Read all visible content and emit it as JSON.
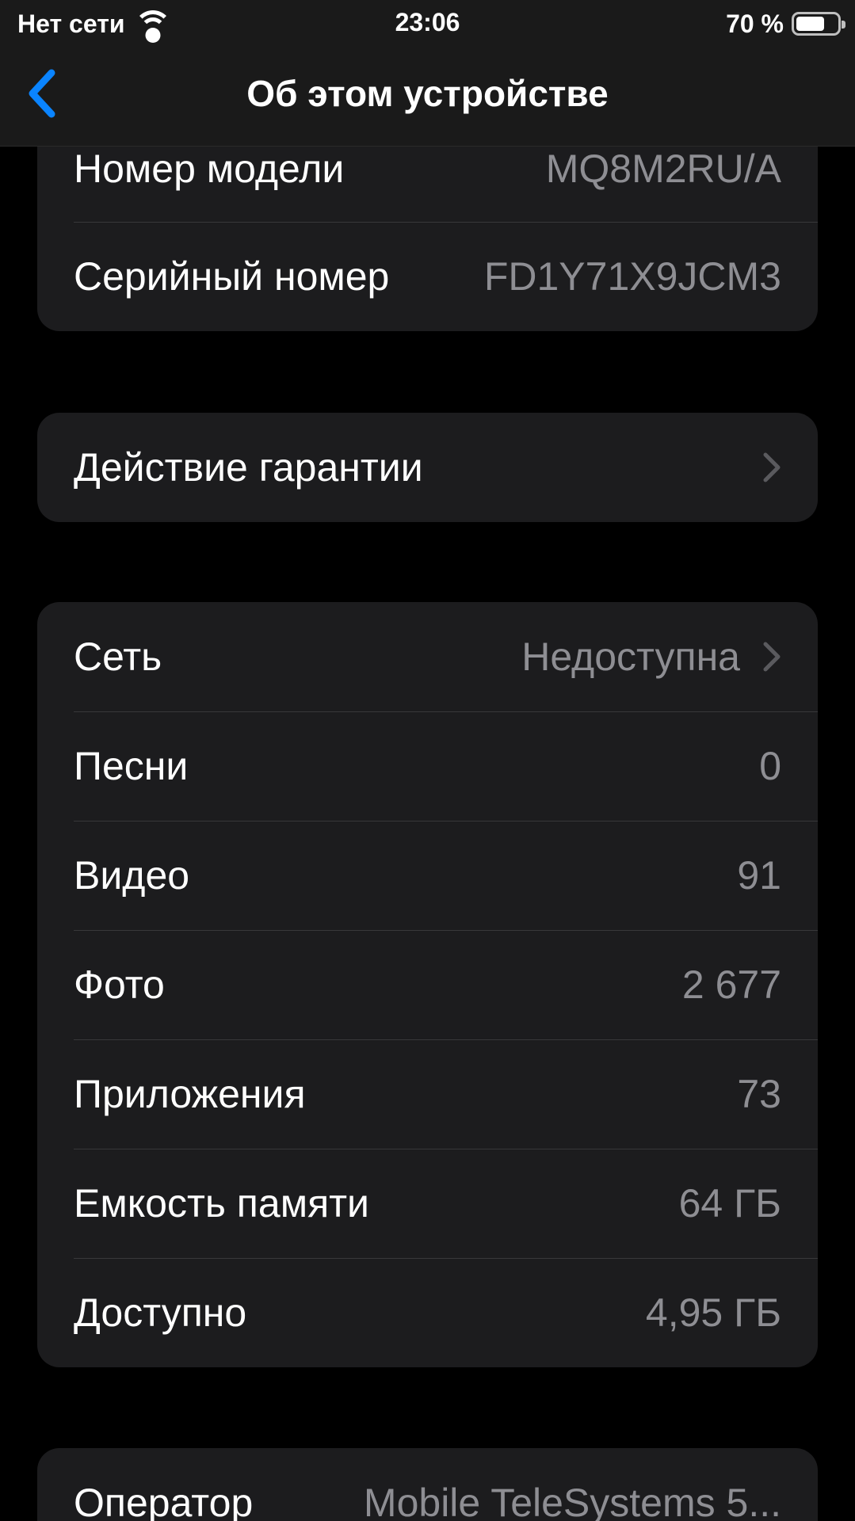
{
  "status_bar": {
    "carrier": "Нет сети",
    "time": "23:06",
    "battery_percent": "70 %",
    "battery_level": 0.7
  },
  "nav": {
    "title": "Об этом устройстве"
  },
  "group_top": {
    "rows": [
      {
        "label": "Номер модели",
        "value": "MQ8M2RU/A"
      },
      {
        "label": "Серийный номер",
        "value": "FD1Y71X9JCM3"
      }
    ]
  },
  "group_warranty": {
    "label": "Действие гарантии"
  },
  "group_media": {
    "rows": [
      {
        "label": "Сеть",
        "value": "Недоступна"
      },
      {
        "label": "Песни",
        "value": "0"
      },
      {
        "label": "Видео",
        "value": "91"
      },
      {
        "label": "Фото",
        "value": "2 677"
      },
      {
        "label": "Приложения",
        "value": "73"
      },
      {
        "label": "Емкость памяти",
        "value": "64 ГБ"
      },
      {
        "label": "Доступно",
        "value": "4,95 ГБ"
      }
    ]
  },
  "group_carrier": {
    "rows": [
      {
        "label": "Оператор",
        "value": "Mobile TeleSystems 5..."
      }
    ]
  },
  "colors": {
    "accent": "#0a84ff",
    "background": "#000000",
    "cell": "#1c1c1e",
    "secondary_text": "#8e8e93",
    "separator": "#38383a"
  },
  "icons": {
    "back": "chevron-left-icon",
    "disclosure": "chevron-right-icon",
    "wifi": "wifi-icon",
    "battery": "battery-icon"
  }
}
